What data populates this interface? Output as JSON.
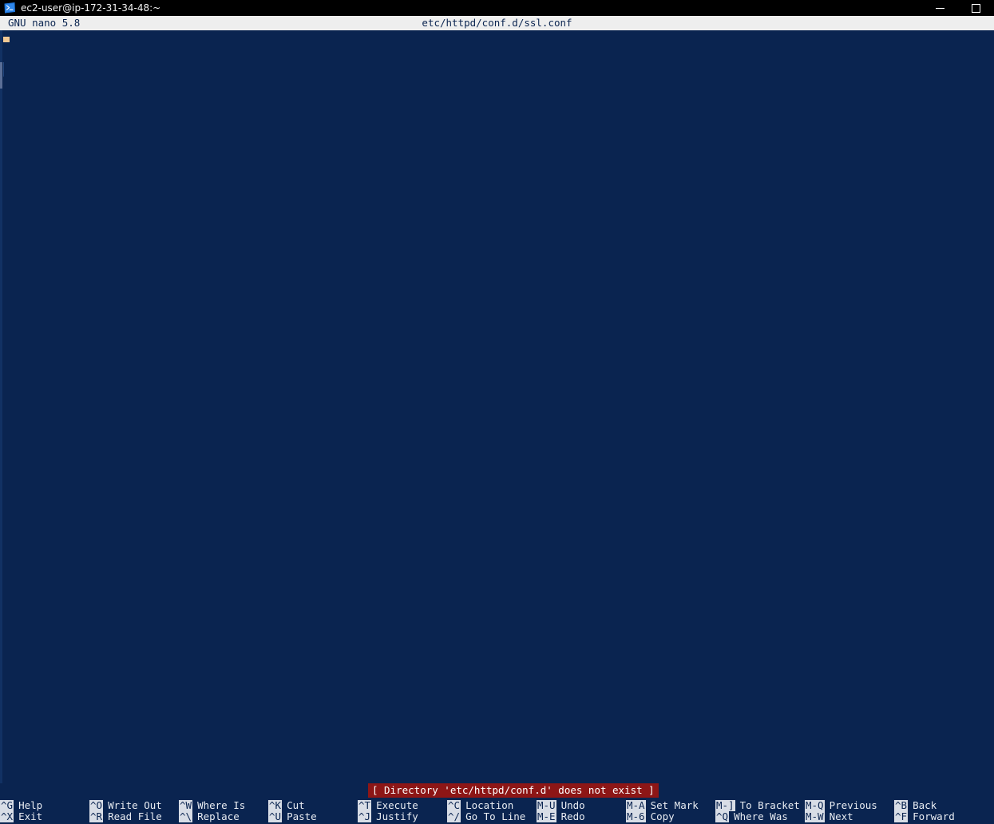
{
  "window": {
    "icon": "terminal-icon",
    "title": "ec2-user@ip-172-31-34-48:~",
    "controls": {
      "minimize": "–",
      "maximize": "□"
    }
  },
  "nano": {
    "version_label": "GNU nano 5.8",
    "filename": "etc/httpd/conf.d/ssl.conf",
    "buffer_text": ""
  },
  "status": {
    "message": "[ Directory 'etc/httpd/conf.d' does not exist ]",
    "background_color": "#8d1616",
    "text_color": "#ffffff"
  },
  "theme": {
    "editor_background": "#0a2450",
    "header_background": "#eeeeee",
    "header_text": "#0a2450",
    "shortcut_text": "#e8ecf2",
    "key_badge_background": "#d8dde6",
    "cursor_color": "#f2c994"
  },
  "shortcuts": [
    {
      "top": {
        "key": "^G",
        "label": "Help"
      },
      "bottom": {
        "key": "^X",
        "label": "Exit"
      }
    },
    {
      "top": {
        "key": "^O",
        "label": "Write Out"
      },
      "bottom": {
        "key": "^R",
        "label": "Read File"
      }
    },
    {
      "top": {
        "key": "^W",
        "label": "Where Is"
      },
      "bottom": {
        "key": "^\\",
        "label": "Replace"
      }
    },
    {
      "top": {
        "key": "^K",
        "label": "Cut"
      },
      "bottom": {
        "key": "^U",
        "label": "Paste"
      }
    },
    {
      "top": {
        "key": "^T",
        "label": "Execute"
      },
      "bottom": {
        "key": "^J",
        "label": "Justify"
      }
    },
    {
      "top": {
        "key": "^C",
        "label": "Location"
      },
      "bottom": {
        "key": "^/",
        "label": "Go To Line"
      }
    },
    {
      "top": {
        "key": "M-U",
        "label": "Undo"
      },
      "bottom": {
        "key": "M-E",
        "label": "Redo"
      }
    },
    {
      "top": {
        "key": "M-A",
        "label": "Set Mark"
      },
      "bottom": {
        "key": "M-6",
        "label": "Copy"
      }
    },
    {
      "top": {
        "key": "M-]",
        "label": "To Bracket"
      },
      "bottom": {
        "key": "^Q",
        "label": "Where Was"
      }
    },
    {
      "top": {
        "key": "M-Q",
        "label": "Previous"
      },
      "bottom": {
        "key": "M-W",
        "label": "Next"
      }
    },
    {
      "top": {
        "key": "^B",
        "label": "Back"
      },
      "bottom": {
        "key": "^F",
        "label": "Forward"
      }
    }
  ]
}
